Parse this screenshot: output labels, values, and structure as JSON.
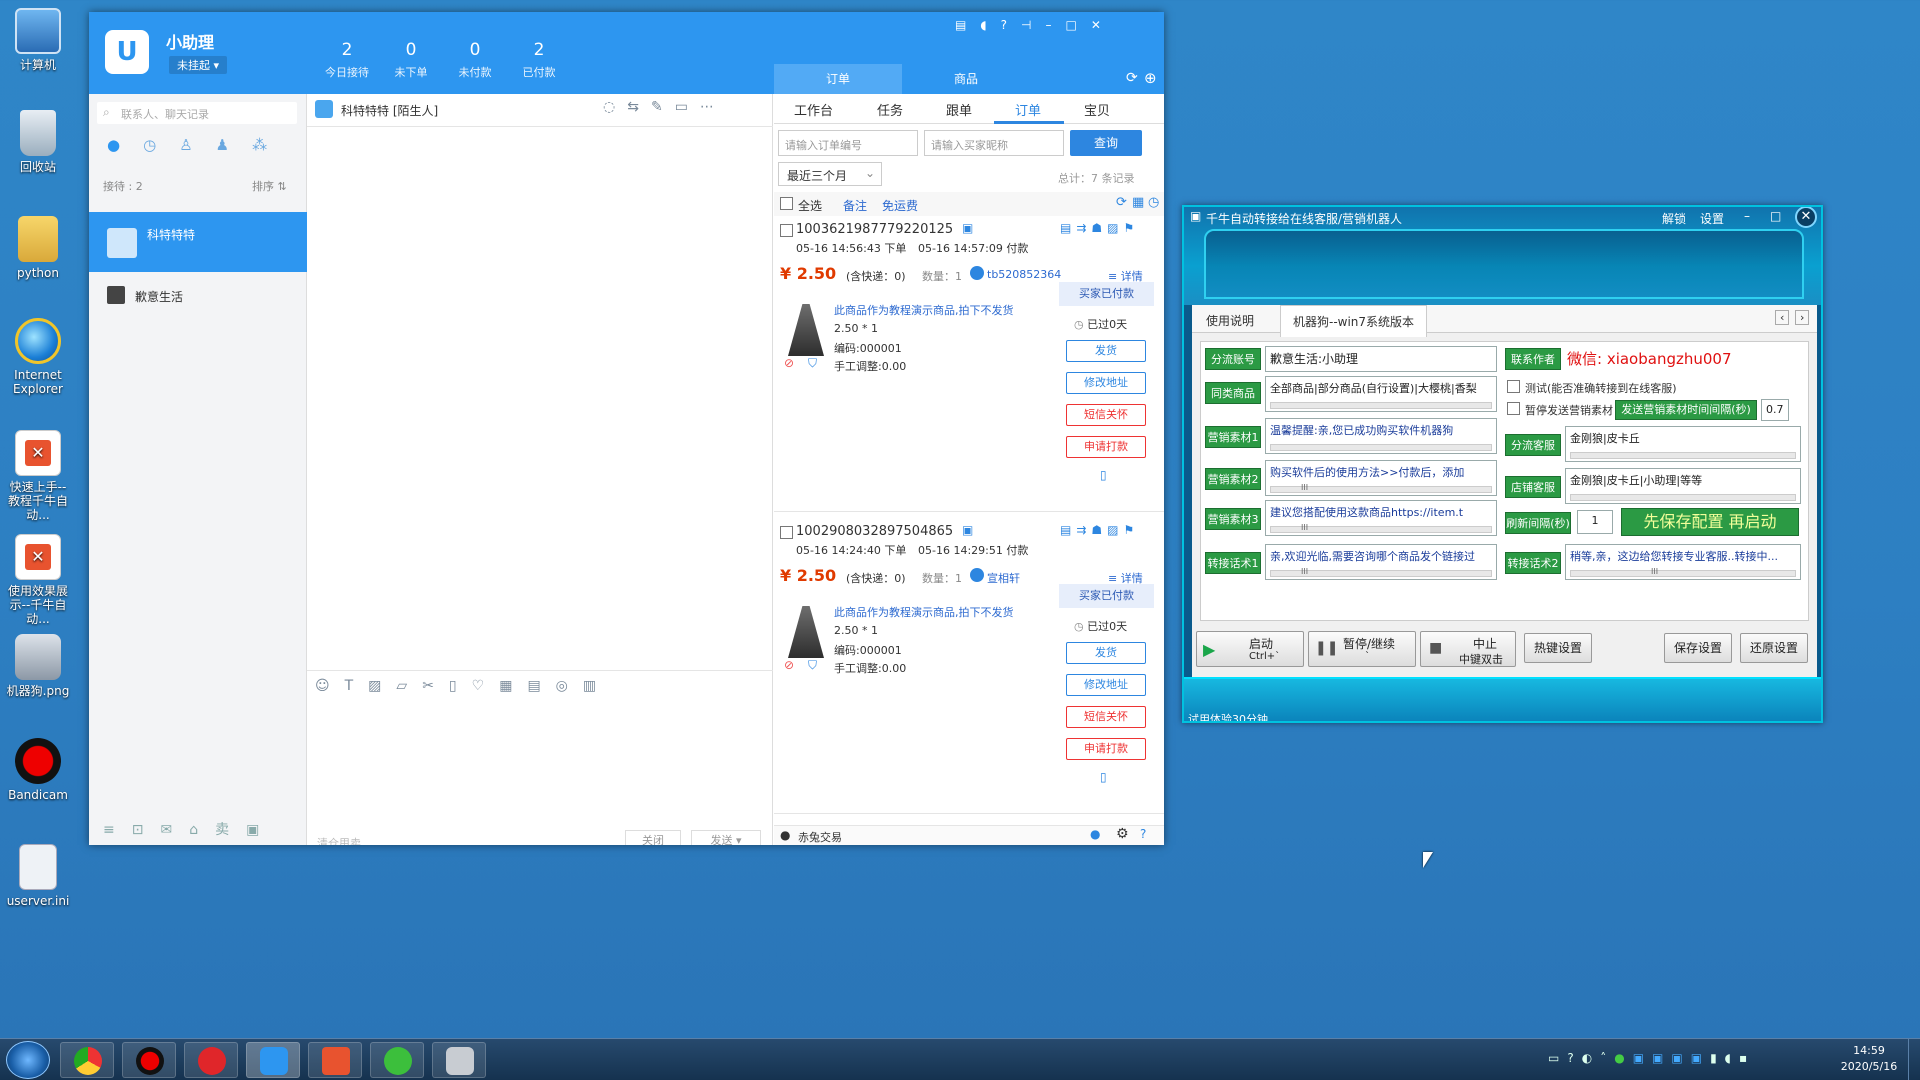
{
  "desktop": {
    "icons": [
      {
        "label": "计算机"
      },
      {
        "label": "回收站"
      },
      {
        "label": "python"
      },
      {
        "label": "Internet Explorer"
      },
      {
        "label": "快速上手--教程千牛自动..."
      },
      {
        "label": "使用效果展示--千牛自动..."
      },
      {
        "label": "机器狗.png"
      },
      {
        "label": "Bandicam"
      },
      {
        "label": "userver.ini"
      }
    ]
  },
  "taskbar": {
    "time": "14:59",
    "date": "2020/5/16"
  },
  "qianniu": {
    "app_name": "小助理",
    "status": "未挂起 ▾",
    "stats": [
      {
        "num": "2",
        "label": "今日接待"
      },
      {
        "num": "0",
        "label": "未下单"
      },
      {
        "num": "0",
        "label": "未付款"
      },
      {
        "num": "2",
        "label": "已付款"
      }
    ],
    "top_tabs": [
      "订单",
      "商品"
    ],
    "search_placeholder": "联系人、聊天记录",
    "reception_count": "接待 : 2",
    "sort_label": "排序 ⇅",
    "contacts": [
      {
        "name": "科特特特"
      },
      {
        "name": "歉意生活"
      }
    ],
    "chat": {
      "title": "科特特特 [陌生人]",
      "input_hint": "清仓甩卖",
      "close_label": "关闭",
      "send_label": "发送 ▾"
    },
    "order_panel": {
      "tabs": [
        "工作台",
        "任务",
        "跟单",
        "订单",
        "宝贝"
      ],
      "order_no_placeholder": "请输入订单编号",
      "buyer_placeholder": "请输入买家昵称",
      "query_label": "查询",
      "range_label": "最近三个月",
      "total_label": "总计：7 条记录",
      "select_all": "全选",
      "remark": "备注",
      "free_shipping": "免运费",
      "orders": [
        {
          "id": "1003621987779220125",
          "placed": "05-16 14:56:43 下单",
          "paid": "05-16 14:57:09 付款",
          "price": "¥ 2.50",
          "shipping": "(含快递：0)",
          "qty": "数量：1",
          "buyer": "tb520852364",
          "detail": "详情",
          "item_title": "此商品作为教程演示商品,拍下不发货",
          "item_price": "2.50 * 1",
          "code": "编码:000001",
          "adjust": "手工调整:0.00",
          "status": "买家已付款",
          "elapsed": "已过0天",
          "actions": [
            "发货",
            "修改地址",
            "短信关怀",
            "申请打款"
          ]
        },
        {
          "id": "1002908032897504865",
          "placed": "05-16 14:24:40 下单",
          "paid": "05-16 14:29:51 付款",
          "price": "¥ 2.50",
          "shipping": "(含快递：0)",
          "qty": "数量：1",
          "buyer": "宣相轩",
          "detail": "详情",
          "item_title": "此商品作为教程演示商品,拍下不发货",
          "item_price": "2.50 * 1",
          "code": "编码:000001",
          "adjust": "手工调整:0.00",
          "status": "买家已付款",
          "elapsed": "已过0天",
          "actions": [
            "发货",
            "修改地址",
            "短信关怀",
            "申请打款"
          ]
        }
      ],
      "footer": "赤兔交易"
    }
  },
  "bot": {
    "title": "千牛自动转接给在线客服/营销机器人",
    "title_links": [
      "解锁",
      "设置"
    ],
    "tabs": [
      "使用说明",
      "机器狗--win7系统版本"
    ],
    "fields": {
      "diversion_account_label": "分流账号",
      "diversion_account_value": "歉意生活:小助理",
      "same_goods_label": "同类商品",
      "same_goods_value": "全部商品|部分商品(自行设置)|大樱桃|香梨",
      "mkt1_label": "营销素材1",
      "mkt1_value": "温馨提醒:亲,您已成功购买软件机器狗",
      "mkt2_label": "营销素材2",
      "mkt2_value": "购买软件后的使用方法>>付款后，添加",
      "mkt3_label": "营销素材3",
      "mkt3_value": "建议您搭配使用这款商品https://item.t",
      "transfer1_label": "转接话术1",
      "transfer1_value": "亲,欢迎光临,需要咨询哪个商品发个链接过",
      "author_label": "联系作者",
      "author_value": "微信: xiaobangzhu007",
      "test_checkbox": "测试(能否准确转接到在线客服)",
      "pause_checkbox": "暂停发送营销素材",
      "interval_label": "发送营销素材时间间隔(秒)",
      "interval_value": "0.7",
      "staff_label": "分流客服",
      "staff_value": "金刚狼|皮卡丘",
      "shop_staff_label": "店铺客服",
      "shop_staff_value": "金刚狼|皮卡丘|小助理|等等",
      "refresh_label": "刷新间隔(秒)",
      "refresh_value": "1",
      "save_notice": "先保存配置 再启动",
      "transfer2_label": "转接话术2",
      "transfer2_value": "稍等,亲，这边给您转接专业客服..转接中..."
    },
    "buttons": {
      "start": "启动",
      "start_hint": "Ctrl+`",
      "pause": "暂停/继续",
      "pause_hint": "`",
      "stop": "中止",
      "stop_hint": "中键双击",
      "hotkey": "热键设置",
      "save": "保存设置",
      "restore": "还原设置"
    },
    "footer": "试用体验30分钟",
    "scroll_glyph": "III"
  },
  "colors": {
    "qianniu_blue": "#2d96f0",
    "bot_green": "#2b9a44",
    "price_red": "#e03a00"
  }
}
